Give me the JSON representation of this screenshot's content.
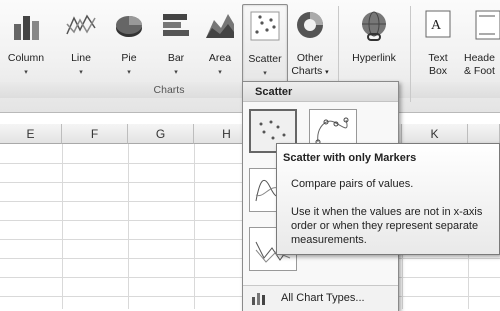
{
  "ribbon": {
    "buttons": [
      {
        "id": "column",
        "label": "Column"
      },
      {
        "id": "line",
        "label": "Line"
      },
      {
        "id": "pie",
        "label": "Pie"
      },
      {
        "id": "bar",
        "label": "Bar"
      },
      {
        "id": "area",
        "label": "Area"
      },
      {
        "id": "scatter",
        "label": "Scatter"
      },
      {
        "id": "other",
        "label": "Other",
        "label2": "Charts"
      },
      {
        "id": "hyperlink",
        "label": "Hyperlink"
      },
      {
        "id": "textbox",
        "label": "Text",
        "label2": "Box"
      },
      {
        "id": "header",
        "label": "Heade",
        "label2": "& Foot"
      }
    ],
    "group_label": "Charts",
    "dropdown_arrow": "▾"
  },
  "sheet": {
    "columns": [
      "E",
      "F",
      "G",
      "H",
      "K"
    ]
  },
  "dropdown": {
    "title": "Scatter",
    "footer": "All Chart Types..."
  },
  "tooltip": {
    "title": "Scatter with only Markers",
    "line1": "Compare pairs of values.",
    "line2": "Use it when the values are not in x-axis order or when they represent separate measurements."
  },
  "colors": {
    "accent": "#8e8e8e",
    "icon_dark": "#555555",
    "icon_mid": "#888888"
  }
}
